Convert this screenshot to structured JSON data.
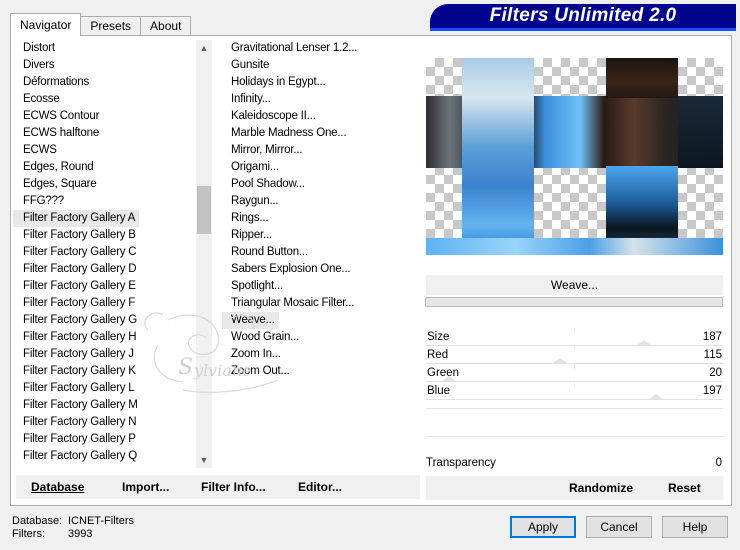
{
  "tabs": [
    "Navigator",
    "Presets",
    "About"
  ],
  "banner_title": "Filters Unlimited 2.0",
  "categories": [
    "Distort",
    "Divers",
    "Déformations",
    "Ecosse",
    "ECWS Contour",
    "ECWS halftone",
    "ECWS",
    "Edges, Round",
    "Edges, Square",
    "FFG???",
    "Filter Factory Gallery A",
    "Filter Factory Gallery B",
    "Filter Factory Gallery C",
    "Filter Factory Gallery D",
    "Filter Factory Gallery E",
    "Filter Factory Gallery F",
    "Filter Factory Gallery G",
    "Filter Factory Gallery H",
    "Filter Factory Gallery J",
    "Filter Factory Gallery K",
    "Filter Factory Gallery L",
    "Filter Factory Gallery M",
    "Filter Factory Gallery N",
    "Filter Factory Gallery P",
    "Filter Factory Gallery Q"
  ],
  "selected_category": "Filter Factory Gallery A",
  "filters": [
    "Gravitational Lenser 1.2...",
    "Gunsite",
    "Holidays in Egypt...",
    "Infinity...",
    "Kaleidoscope II...",
    "Marble Madness One...",
    "Mirror, Mirror...",
    "Origami...",
    "Pool Shadow...",
    "Raygun...",
    "Rings...",
    "Ripper...",
    "Round Button...",
    "Sabers Explosion One...",
    "Spotlight...",
    "Triangular Mosaic Filter...",
    "Weave...",
    "Wood Grain...",
    "Zoom In...",
    "Zoom Out..."
  ],
  "selected_filter": "Weave...",
  "left_buttons": {
    "database": "Database",
    "import": "Import...",
    "filter_info": "Filter Info...",
    "editor": "Editor..."
  },
  "current_filter_name": "Weave...",
  "progress": 0,
  "params": [
    {
      "label": "Size",
      "value": "187",
      "level": 0.733
    },
    {
      "label": "Red",
      "value": "115",
      "level": 0.451
    },
    {
      "label": "Green",
      "value": "20",
      "level": 0.078
    },
    {
      "label": "Blue",
      "value": "197",
      "level": 0.773
    }
  ],
  "transparency": {
    "label": "Transparency",
    "value": "0"
  },
  "right_buttons": {
    "randomize": "Randomize",
    "reset": "Reset"
  },
  "status": {
    "database_label": "Database:",
    "database_value": "ICNET-Filters",
    "filters_label": "Filters:",
    "filters_value": "3993"
  },
  "dialog_buttons": {
    "apply": "Apply",
    "cancel": "Cancel",
    "help": "Help"
  },
  "colors": {
    "banner": "#00038c",
    "accent": "#0078d7"
  },
  "watermark": "Sylviane"
}
